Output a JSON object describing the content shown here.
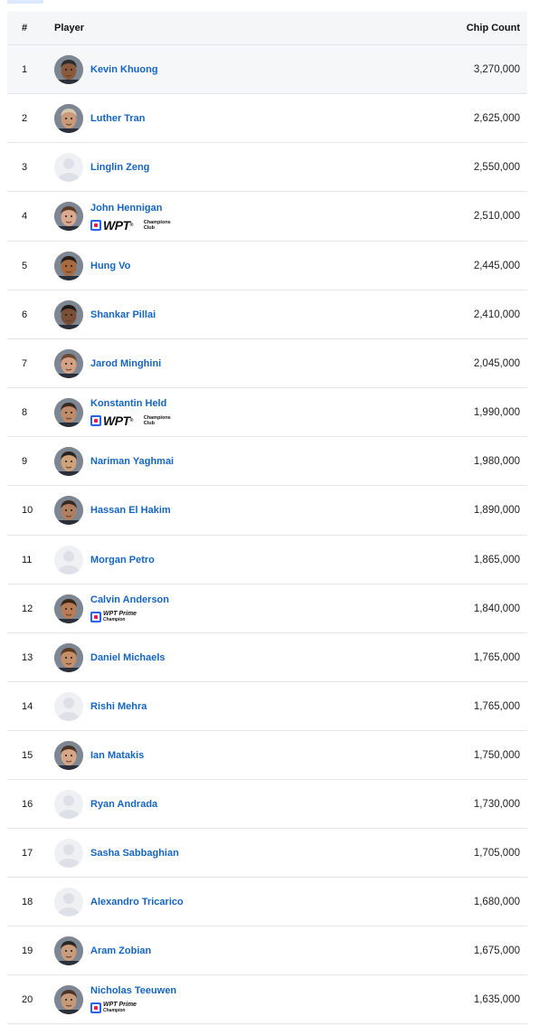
{
  "header": {
    "rank": "#",
    "player": "Player",
    "chips": "Chip Count"
  },
  "badges": {
    "wpt_logo": "WPT",
    "wpt_trademark": "®",
    "champions_club": "Champions Club",
    "prime_logo": "WPT Prime",
    "prime_champion": "Champion"
  },
  "rows": [
    {
      "rank": "1",
      "name": "Kevin Khuong",
      "chips": "3,270,000",
      "avatar": "photo",
      "skin": "#8a5a3c",
      "hair": "#2b2b2b",
      "badge": "",
      "highlight": true
    },
    {
      "rank": "2",
      "name": "Luther Tran",
      "chips": "2,625,000",
      "avatar": "photo",
      "skin": "#c99a7a",
      "hair": "#d7c6b0",
      "badge": ""
    },
    {
      "rank": "3",
      "name": "Linglin Zeng",
      "chips": "2,550,000",
      "avatar": "placeholder",
      "badge": ""
    },
    {
      "rank": "4",
      "name": "John Hennigan",
      "chips": "2,510,000",
      "avatar": "photo",
      "skin": "#d9a88e",
      "hair": "#5b3b2a",
      "badge": "champions"
    },
    {
      "rank": "5",
      "name": "Hung Vo",
      "chips": "2,445,000",
      "avatar": "photo",
      "skin": "#a86a3e",
      "hair": "#241b15",
      "badge": ""
    },
    {
      "rank": "6",
      "name": "Shankar Pillai",
      "chips": "2,410,000",
      "avatar": "photo",
      "skin": "#7a4f36",
      "hair": "#1f1a17",
      "badge": ""
    },
    {
      "rank": "7",
      "name": "Jarod Minghini",
      "chips": "2,045,000",
      "avatar": "photo",
      "skin": "#d4a184",
      "hair": "#6b4a34",
      "badge": ""
    },
    {
      "rank": "8",
      "name": "Konstantin Held",
      "chips": "1,990,000",
      "avatar": "photo",
      "skin": "#c08b6a",
      "hair": "#3a2b22",
      "badge": "champions"
    },
    {
      "rank": "9",
      "name": "Nariman Yaghmai",
      "chips": "1,980,000",
      "avatar": "photo",
      "skin": "#d0a27c",
      "hair": "#2a2420",
      "badge": ""
    },
    {
      "rank": "10",
      "name": "Hassan El Hakim",
      "chips": "1,890,000",
      "avatar": "photo",
      "skin": "#b07e60",
      "hair": "#3b2a20",
      "badge": ""
    },
    {
      "rank": "11",
      "name": "Morgan Petro",
      "chips": "1,865,000",
      "avatar": "placeholder",
      "badge": ""
    },
    {
      "rank": "12",
      "name": "Calvin Anderson",
      "chips": "1,840,000",
      "avatar": "photo",
      "skin": "#b97d55",
      "hair": "#3b2616",
      "badge": "prime"
    },
    {
      "rank": "13",
      "name": "Daniel Michaels",
      "chips": "1,765,000",
      "avatar": "photo",
      "skin": "#c68f6a",
      "hair": "#5b3a22",
      "badge": ""
    },
    {
      "rank": "14",
      "name": "Rishi Mehra",
      "chips": "1,765,000",
      "avatar": "placeholder",
      "badge": ""
    },
    {
      "rank": "15",
      "name": "Ian Matakis",
      "chips": "1,750,000",
      "avatar": "photo",
      "skin": "#d7a587",
      "hair": "#4a3424",
      "badge": ""
    },
    {
      "rank": "16",
      "name": "Ryan Andrada",
      "chips": "1,730,000",
      "avatar": "placeholder",
      "badge": ""
    },
    {
      "rank": "17",
      "name": "Sasha Sabbaghian",
      "chips": "1,705,000",
      "avatar": "placeholder",
      "badge": ""
    },
    {
      "rank": "18",
      "name": "Alexandro Tricarico",
      "chips": "1,680,000",
      "avatar": "placeholder",
      "badge": ""
    },
    {
      "rank": "19",
      "name": "Aram Zobian",
      "chips": "1,675,000",
      "avatar": "photo",
      "skin": "#c99c7d",
      "hair": "#2c2622",
      "badge": ""
    },
    {
      "rank": "20",
      "name": "Nicholas Teeuwen",
      "chips": "1,635,000",
      "avatar": "photo",
      "skin": "#c69a78",
      "hair": "#4a3426",
      "badge": "prime"
    }
  ]
}
